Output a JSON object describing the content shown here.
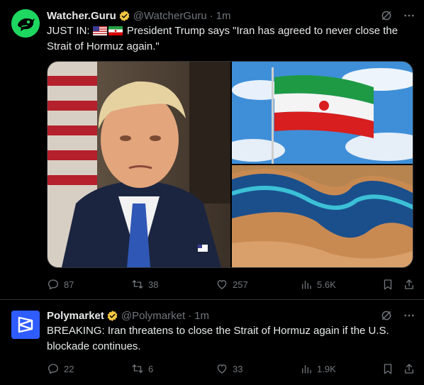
{
  "tweets": [
    {
      "name": "Watcher.Guru",
      "handle": "@WatcherGuru",
      "time": "1m",
      "text_prefix": "JUST IN:",
      "text_body": "President Trump says \"Iran has agreed to never close the Strait of Hormuz again.\"",
      "replies": "87",
      "reposts": "38",
      "likes": "257",
      "views": "5.6K"
    },
    {
      "name": "Polymarket",
      "handle": "@Polymarket",
      "time": "1m",
      "text": "BREAKING: Iran threatens to close the Strait of Hormuz again if the U.S. blockade continues.",
      "replies": "22",
      "reposts": "6",
      "likes": "33",
      "views": "1.9K"
    }
  ],
  "colors": {
    "background": "#000000",
    "text": "#e7e9ea",
    "muted": "#71767b",
    "verified": "#f5c842",
    "watcher_brand": "#1ed760",
    "polymarket_brand": "#2e5cff"
  }
}
